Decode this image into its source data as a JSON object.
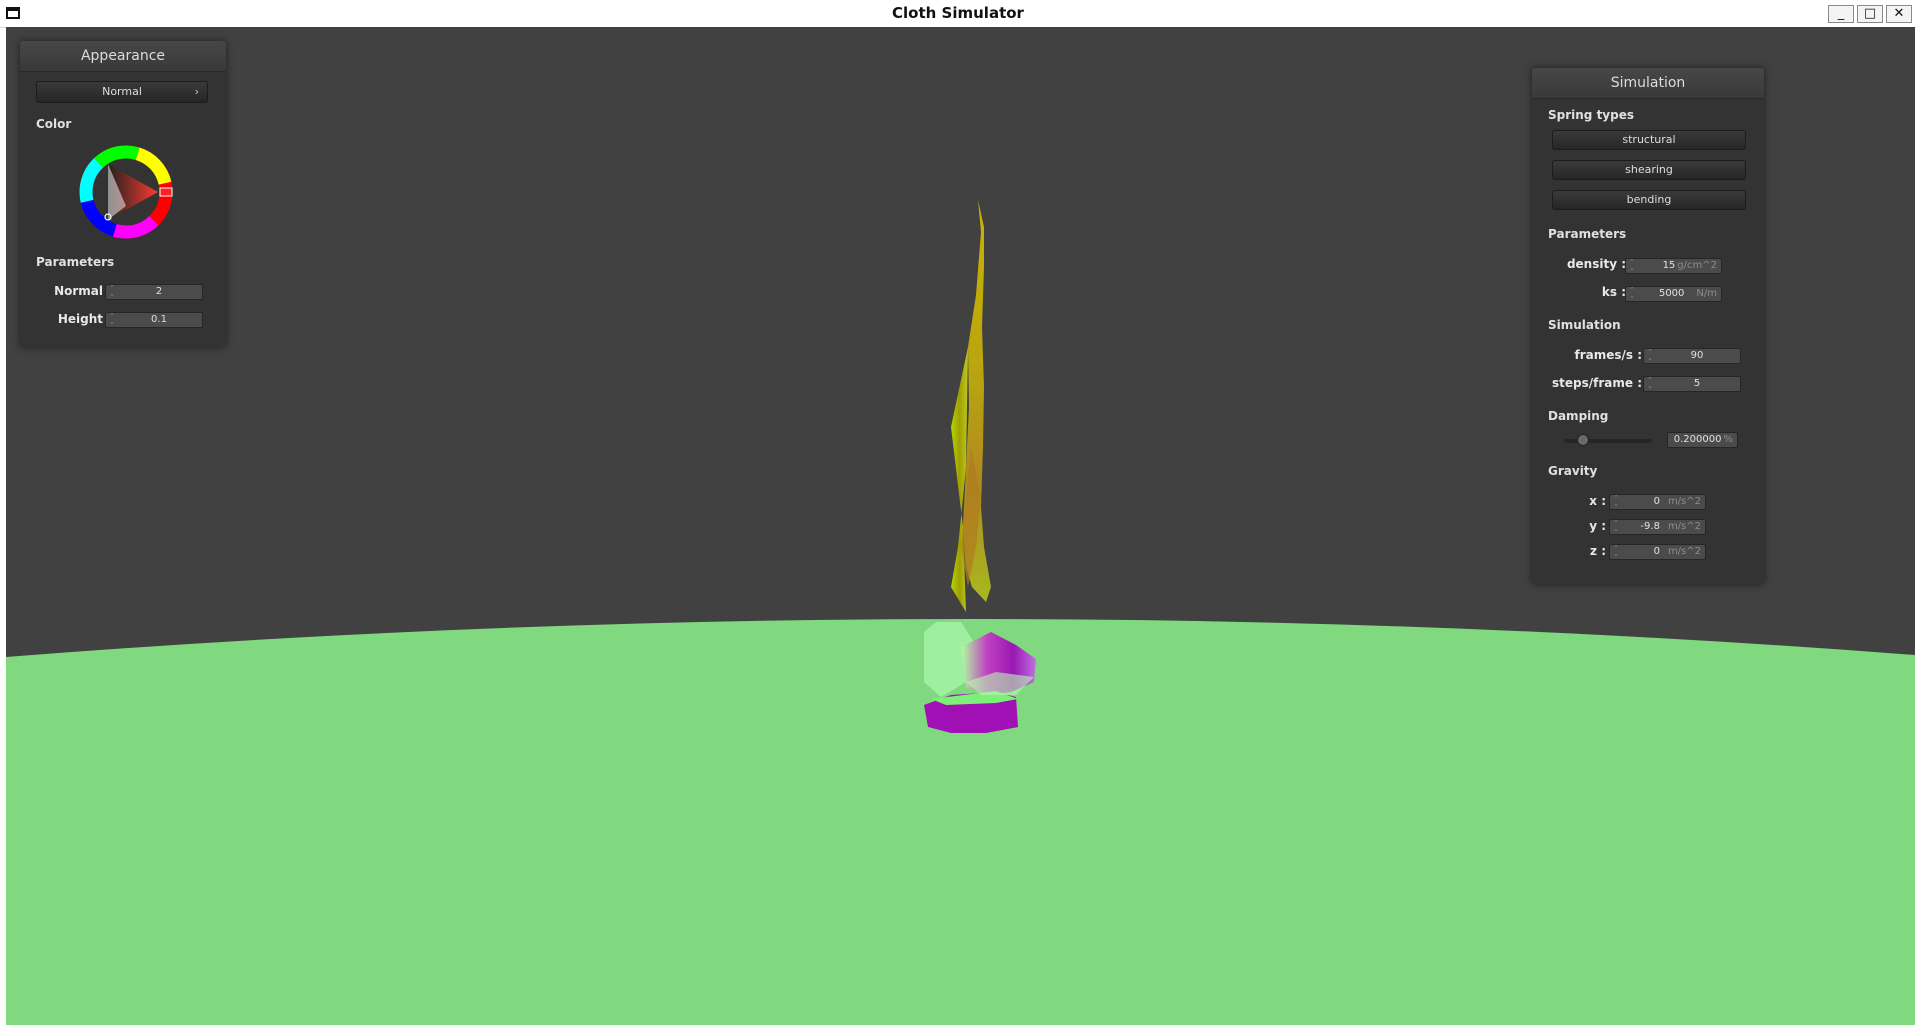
{
  "window": {
    "title": "Cloth Simulator",
    "minimize_glyph": "_",
    "maximize_glyph": "□",
    "close_glyph": "✕"
  },
  "colors": {
    "background": "#414141",
    "ground": "#80d97e",
    "panel": "#333333",
    "panel_header": "#404040",
    "input_box": "#4b4b4b"
  },
  "appearance_panel": {
    "title": "Appearance",
    "shader_dropdown": {
      "selected": "Normal",
      "arrow": "›"
    },
    "color_label": "Color",
    "parameters_label": "Parameters",
    "normal": {
      "label": "Normal :",
      "value": "2"
    },
    "height": {
      "label": "Height :",
      "value": "0.1"
    }
  },
  "simulation_panel": {
    "title": "Simulation",
    "spring_types_label": "Spring types",
    "spring_buttons": [
      "structural",
      "shearing",
      "bending"
    ],
    "parameters_label": "Parameters",
    "density": {
      "label": "density :",
      "value": "15",
      "unit": "g/cm^2"
    },
    "ks": {
      "label": "ks :",
      "value": "5000",
      "unit": "N/m"
    },
    "simulation_label": "Simulation",
    "frames_per_s": {
      "label": "frames/s :",
      "value": "90"
    },
    "steps_per_frame": {
      "label": "steps/frame :",
      "value": "5"
    },
    "damping_label": "Damping",
    "damping": {
      "value": "0.200000",
      "unit": "%",
      "slider_fraction": 0.2
    },
    "gravity_label": "Gravity",
    "gravity_x": {
      "label": "x :",
      "value": "0",
      "unit": "m/s^2"
    },
    "gravity_y": {
      "label": "y :",
      "value": "-9.8",
      "unit": "m/s^2"
    },
    "gravity_z": {
      "label": "z :",
      "value": "0",
      "unit": "m/s^2"
    }
  }
}
